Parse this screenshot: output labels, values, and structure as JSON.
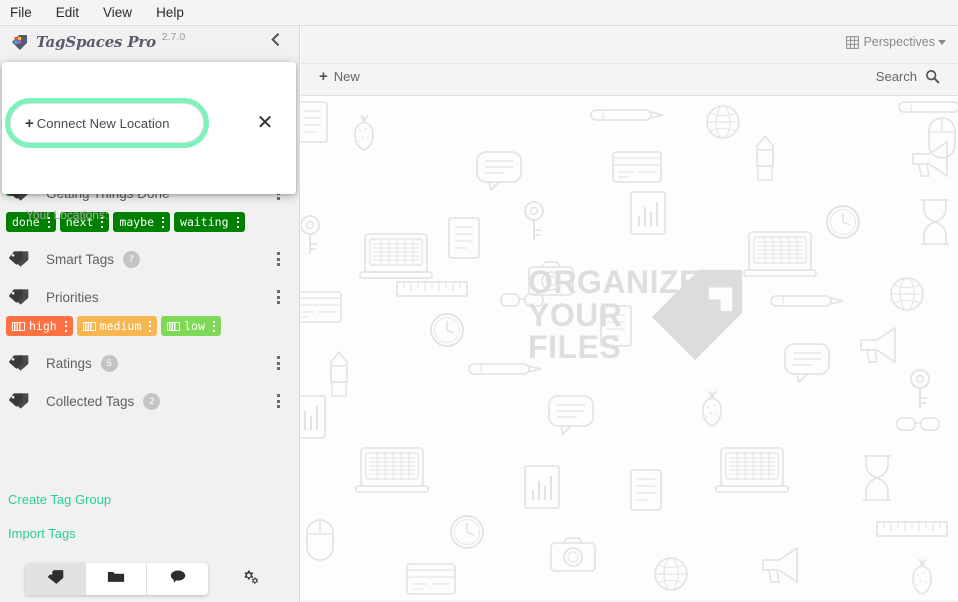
{
  "menubar": {
    "items": [
      {
        "label": "File"
      },
      {
        "label": "Edit"
      },
      {
        "label": "View"
      },
      {
        "label": "Help"
      }
    ]
  },
  "sidebar": {
    "brand": "TagSpaces Pro",
    "version": "2.7.0",
    "collapse_icon": "chevron-left-icon",
    "popup": {
      "connect_label": "Connect New Location",
      "connect_plus": "+",
      "close_icon": "✕",
      "your_locations_label": "Your Locations:",
      "highlight_color": "#7df2bb"
    },
    "tag_groups": [
      {
        "name": "Getting Things Done",
        "badge": "",
        "tags": [
          {
            "label": "done",
            "color": "#008000",
            "icon": false
          },
          {
            "label": "next",
            "color": "#008000",
            "icon": false
          },
          {
            "label": "maybe",
            "color": "#008000",
            "icon": false
          },
          {
            "label": "waiting",
            "color": "#008000",
            "icon": false
          }
        ]
      },
      {
        "name": "Smart Tags",
        "badge": "7",
        "tags": []
      },
      {
        "name": "Priorities",
        "badge": "",
        "tags": [
          {
            "label": "high",
            "color": "#ff7043",
            "icon": true
          },
          {
            "label": "medium",
            "color": "#f7b650",
            "icon": true
          },
          {
            "label": "low",
            "color": "#7ed957",
            "icon": true
          }
        ]
      },
      {
        "name": "Ratings",
        "badge": "5",
        "tags": []
      },
      {
        "name": "Collected Tags",
        "badge": "2",
        "tags": []
      }
    ],
    "links": [
      {
        "label": "Create Tag Group"
      },
      {
        "label": "Import Tags"
      }
    ],
    "link_color": "#2ecc9b",
    "bottom_bar": {
      "buttons": [
        {
          "icon": "tag-icon",
          "active": true
        },
        {
          "icon": "folder-icon",
          "active": false
        },
        {
          "icon": "chat-icon",
          "active": false
        }
      ],
      "settings_icon": "gears-icon"
    }
  },
  "main": {
    "perspectives_label": "Perspectives",
    "perspectives_icon": "grid-icon",
    "new_label": "New",
    "new_plus": "+",
    "search_label": "Search",
    "search_icon": "magnifier-icon",
    "watermark": {
      "line1": "ORGANIZE",
      "line2": "YOUR",
      "line3": "FILES",
      "logo": "tag-logo-icon",
      "color": "#dedede"
    }
  }
}
